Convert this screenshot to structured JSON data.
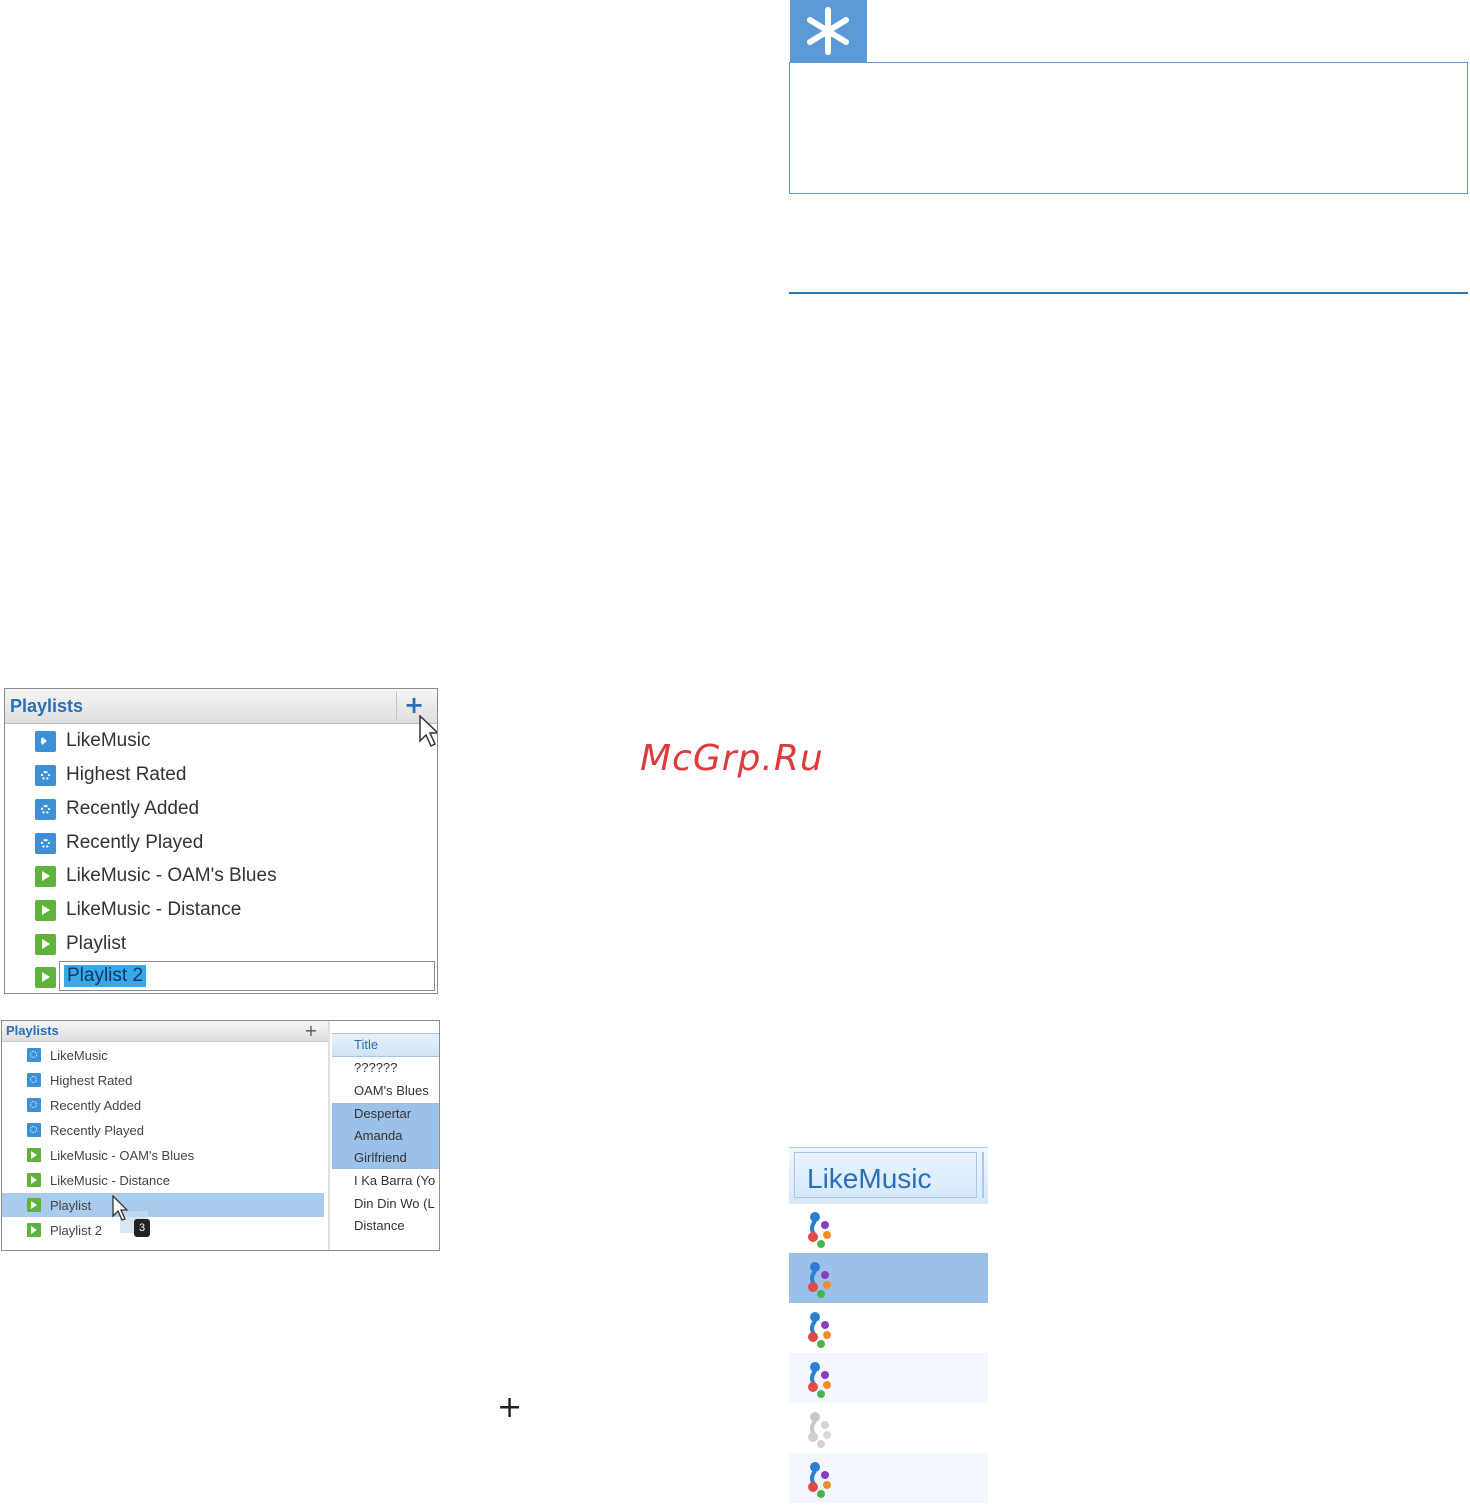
{
  "watermark": "McGrp.Ru",
  "playlists_panel": {
    "title": "Playlists",
    "add_button": "+",
    "items": [
      {
        "label": "LikeMusic",
        "icon": "music-playlist-icon"
      },
      {
        "label": "Highest Rated",
        "icon": "smart-playlist-icon"
      },
      {
        "label": "Recently Added",
        "icon": "smart-playlist-icon"
      },
      {
        "label": "Recently Played",
        "icon": "smart-playlist-icon"
      },
      {
        "label": "LikeMusic - OAM's Blues",
        "icon": "playlist-icon"
      },
      {
        "label": "LikeMusic - Distance",
        "icon": "playlist-icon"
      },
      {
        "label": "Playlist",
        "icon": "playlist-icon"
      }
    ],
    "rename_value": "Playlist 2"
  },
  "drag_panel": {
    "title": "Playlists",
    "add_button": "+",
    "items": [
      {
        "label": "LikeMusic"
      },
      {
        "label": "Highest Rated"
      },
      {
        "label": "Recently Added"
      },
      {
        "label": "Recently Played"
      },
      {
        "label": "LikeMusic - OAM's Blues"
      },
      {
        "label": "LikeMusic - Distance"
      },
      {
        "label": "Playlist"
      },
      {
        "label": "Playlist 2"
      }
    ],
    "drag_count": "3",
    "songs_column_header": "Title",
    "songs": [
      "??????",
      "OAM's Blues",
      "Despertar",
      "Amanda",
      "Girlfriend",
      "I Ka Barra (Yo",
      "Din Din Wo (L",
      "Distance"
    ],
    "selected_songs": [
      "Despertar",
      "Amanda",
      "Girlfriend"
    ]
  },
  "plus_sign": "+",
  "likemusic_column": {
    "header": "LikeMusic"
  },
  "colors": {
    "accent": "#2a6fb8",
    "tip_blue": "#5b9bd5",
    "selection": "#9cc1e8",
    "watermark": "#e03a3a"
  }
}
